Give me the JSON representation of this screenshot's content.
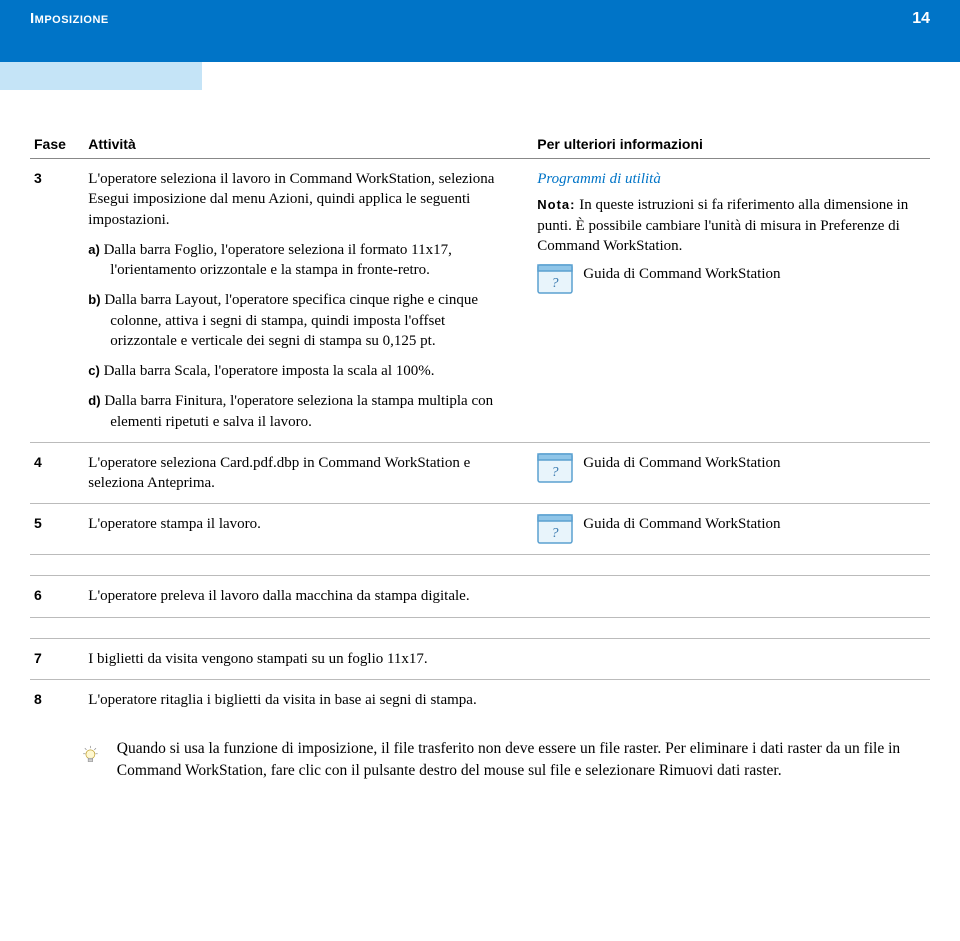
{
  "header": {
    "title": "Imposizione",
    "page": "14"
  },
  "columns": {
    "phase": "Fase",
    "activity": "Attività",
    "info": "Per ulteriori informazioni"
  },
  "rows": {
    "r3": {
      "phase": "3",
      "intro": "L'operatore seleziona il lavoro in Command WorkStation, seleziona Esegui imposizione dal menu Azioni, quindi applica le seguenti impostazioni.",
      "a_label": "a)",
      "a": "Dalla barra Foglio, l'operatore seleziona il formato 11x17, l'orientamento orizzontale e la stampa in fronte-retro.",
      "b_label": "b)",
      "b": "Dalla barra Layout, l'operatore specifica cinque righe e cinque colonne, attiva i segni di stampa, quindi imposta l'offset orizzontale e verticale dei segni di stampa su 0,125 pt.",
      "c_label": "c)",
      "c": "Dalla barra Scala, l'operatore imposta la scala al 100%.",
      "d_label": "d)",
      "d": "Dalla barra Finitura, l'operatore seleziona la stampa multipla con elementi ripetuti e salva il lavoro.",
      "info_link": "Programmi di utilità",
      "nota_label": "Nota:",
      "nota_text": "In queste istruzioni si fa riferimento alla dimensione in punti. È possibile cambiare l'unità di misura in Preferenze di Command WorkStation.",
      "guide": "Guida di Command WorkStation"
    },
    "r4": {
      "phase": "4",
      "activity": "L'operatore seleziona Card.pdf.dbp in Command WorkStation e seleziona Anteprima.",
      "guide": "Guida di Command WorkStation"
    },
    "r5": {
      "phase": "5",
      "activity": "L'operatore stampa il lavoro.",
      "guide": "Guida di Command WorkStation"
    },
    "r6": {
      "phase": "6",
      "activity": "L'operatore preleva il lavoro dalla macchina da stampa digitale."
    },
    "r7": {
      "phase": "7",
      "activity": "I biglietti da visita vengono stampati su un foglio 11x17."
    },
    "r8": {
      "phase": "8",
      "activity": "L'operatore ritaglia i biglietti da visita in base ai segni di stampa."
    }
  },
  "tip": "Quando si usa la funzione di imposizione, il file trasferito non deve essere un file raster. Per eliminare i dati raster da un file in Command WorkStation, fare clic con il pulsante destro del mouse sul file e selezionare Rimuovi dati raster."
}
